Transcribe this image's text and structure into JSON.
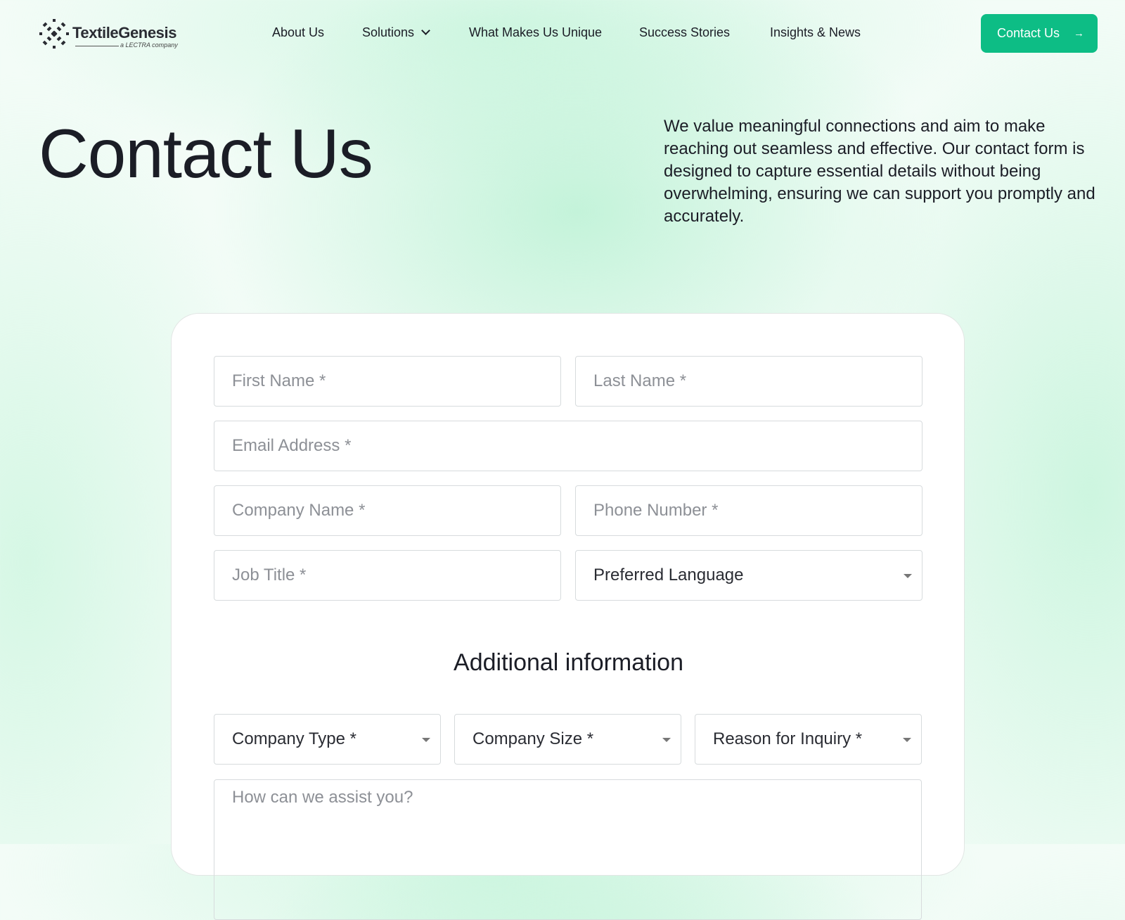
{
  "brand": {
    "name": "TextileGenesis",
    "tagline": "a LECTRA company",
    "icon": "woven-x-logo-icon"
  },
  "nav": {
    "items": [
      {
        "label": "About Us"
      },
      {
        "label": "Solutions",
        "icon": "chevron-down-icon"
      },
      {
        "label": "What Makes Us Unique"
      },
      {
        "label": "Success Stories"
      },
      {
        "label": "Insights & News"
      }
    ],
    "cta_label": "Contact Us",
    "cta_icon": "arrow-right-icon"
  },
  "hero": {
    "title": "Contact Us",
    "intro": "We value meaningful connections and aim to make reaching out seamless and effective. Our contact form is designed to capture essential details without being overwhelming, ensuring we can support you promptly and accurately."
  },
  "form": {
    "first_name_placeholder": "First Name *",
    "last_name_placeholder": "Last Name *",
    "email_placeholder": "Email Address *",
    "company_name_placeholder": "Company Name *",
    "phone_placeholder": "Phone Number *",
    "job_title_placeholder": "Job Title *",
    "preferred_language_value": "Preferred Language",
    "additional_title": "Additional information",
    "company_type_value": "Company Type *",
    "company_size_value": "Company Size *",
    "reason_value": "Reason for Inquiry *",
    "message_placeholder": "How can we assist you?"
  },
  "colors": {
    "accent": "#0dbd85",
    "text": "#1b1d26",
    "placeholder": "#8d9096",
    "background_tint": "#d9f7e8"
  }
}
